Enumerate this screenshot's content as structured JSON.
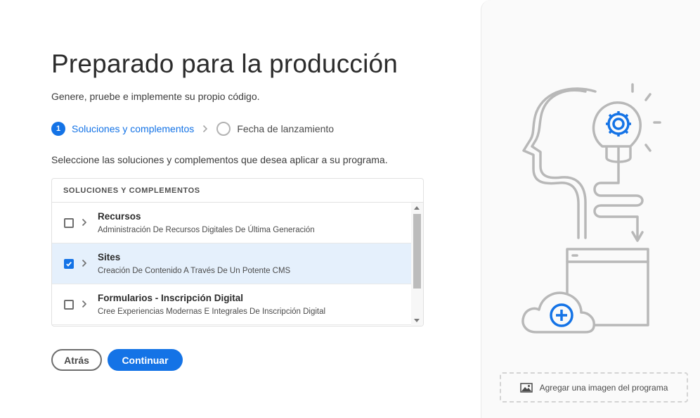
{
  "header": {
    "title": "Preparado para la producción",
    "subtitle": "Genere, pruebe e implemente su propio código."
  },
  "steps": [
    {
      "number": "1",
      "label": "Soluciones y complementos",
      "state": "active"
    },
    {
      "number": "",
      "label": "Fecha de lanzamiento",
      "state": "inactive"
    }
  ],
  "instruction": "Seleccione las soluciones y complementos que desea aplicar a su programa.",
  "table": {
    "header": "SOLUCIONES Y COMPLEMENTOS",
    "rows": [
      {
        "name": "Recursos",
        "description": "Administración De Recursos Digitales De Última Generación",
        "checked": false
      },
      {
        "name": "Sites",
        "description": "Creación De Contenido A Través De Un Potente CMS",
        "checked": true
      },
      {
        "name": "Formularios - Inscripción Digital",
        "description": "Cree Experiencias Modernas E Integrales De Inscripción Digital",
        "checked": false
      }
    ]
  },
  "buttons": {
    "back": "Atrás",
    "continue": "Continuar"
  },
  "right_panel": {
    "add_image_label": "Agregar una imagen del programa",
    "illustration_icons": [
      "head-outline-icon",
      "lightbulb-gear-icon",
      "browser-window-icon",
      "cloud-add-icon"
    ]
  },
  "colors": {
    "accent": "#1473e6",
    "selected_row": "#e5f0fc",
    "illustration_gray": "#b8b8b8"
  }
}
